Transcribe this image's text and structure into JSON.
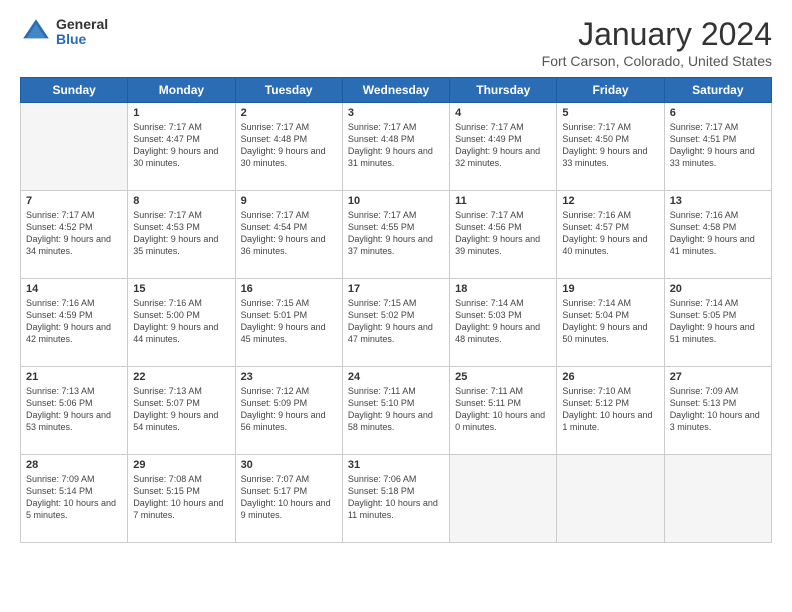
{
  "header": {
    "logo_general": "General",
    "logo_blue": "Blue",
    "title": "January 2024",
    "location": "Fort Carson, Colorado, United States"
  },
  "days_of_week": [
    "Sunday",
    "Monday",
    "Tuesday",
    "Wednesday",
    "Thursday",
    "Friday",
    "Saturday"
  ],
  "weeks": [
    [
      {
        "num": "",
        "sunrise": "",
        "sunset": "",
        "daylight": "",
        "gray": true
      },
      {
        "num": "1",
        "sunrise": "Sunrise: 7:17 AM",
        "sunset": "Sunset: 4:47 PM",
        "daylight": "Daylight: 9 hours and 30 minutes.",
        "gray": false
      },
      {
        "num": "2",
        "sunrise": "Sunrise: 7:17 AM",
        "sunset": "Sunset: 4:48 PM",
        "daylight": "Daylight: 9 hours and 30 minutes.",
        "gray": false
      },
      {
        "num": "3",
        "sunrise": "Sunrise: 7:17 AM",
        "sunset": "Sunset: 4:48 PM",
        "daylight": "Daylight: 9 hours and 31 minutes.",
        "gray": false
      },
      {
        "num": "4",
        "sunrise": "Sunrise: 7:17 AM",
        "sunset": "Sunset: 4:49 PM",
        "daylight": "Daylight: 9 hours and 32 minutes.",
        "gray": false
      },
      {
        "num": "5",
        "sunrise": "Sunrise: 7:17 AM",
        "sunset": "Sunset: 4:50 PM",
        "daylight": "Daylight: 9 hours and 33 minutes.",
        "gray": false
      },
      {
        "num": "6",
        "sunrise": "Sunrise: 7:17 AM",
        "sunset": "Sunset: 4:51 PM",
        "daylight": "Daylight: 9 hours and 33 minutes.",
        "gray": false
      }
    ],
    [
      {
        "num": "7",
        "sunrise": "Sunrise: 7:17 AM",
        "sunset": "Sunset: 4:52 PM",
        "daylight": "Daylight: 9 hours and 34 minutes.",
        "gray": false
      },
      {
        "num": "8",
        "sunrise": "Sunrise: 7:17 AM",
        "sunset": "Sunset: 4:53 PM",
        "daylight": "Daylight: 9 hours and 35 minutes.",
        "gray": false
      },
      {
        "num": "9",
        "sunrise": "Sunrise: 7:17 AM",
        "sunset": "Sunset: 4:54 PM",
        "daylight": "Daylight: 9 hours and 36 minutes.",
        "gray": false
      },
      {
        "num": "10",
        "sunrise": "Sunrise: 7:17 AM",
        "sunset": "Sunset: 4:55 PM",
        "daylight": "Daylight: 9 hours and 37 minutes.",
        "gray": false
      },
      {
        "num": "11",
        "sunrise": "Sunrise: 7:17 AM",
        "sunset": "Sunset: 4:56 PM",
        "daylight": "Daylight: 9 hours and 39 minutes.",
        "gray": false
      },
      {
        "num": "12",
        "sunrise": "Sunrise: 7:16 AM",
        "sunset": "Sunset: 4:57 PM",
        "daylight": "Daylight: 9 hours and 40 minutes.",
        "gray": false
      },
      {
        "num": "13",
        "sunrise": "Sunrise: 7:16 AM",
        "sunset": "Sunset: 4:58 PM",
        "daylight": "Daylight: 9 hours and 41 minutes.",
        "gray": false
      }
    ],
    [
      {
        "num": "14",
        "sunrise": "Sunrise: 7:16 AM",
        "sunset": "Sunset: 4:59 PM",
        "daylight": "Daylight: 9 hours and 42 minutes.",
        "gray": false
      },
      {
        "num": "15",
        "sunrise": "Sunrise: 7:16 AM",
        "sunset": "Sunset: 5:00 PM",
        "daylight": "Daylight: 9 hours and 44 minutes.",
        "gray": false
      },
      {
        "num": "16",
        "sunrise": "Sunrise: 7:15 AM",
        "sunset": "Sunset: 5:01 PM",
        "daylight": "Daylight: 9 hours and 45 minutes.",
        "gray": false
      },
      {
        "num": "17",
        "sunrise": "Sunrise: 7:15 AM",
        "sunset": "Sunset: 5:02 PM",
        "daylight": "Daylight: 9 hours and 47 minutes.",
        "gray": false
      },
      {
        "num": "18",
        "sunrise": "Sunrise: 7:14 AM",
        "sunset": "Sunset: 5:03 PM",
        "daylight": "Daylight: 9 hours and 48 minutes.",
        "gray": false
      },
      {
        "num": "19",
        "sunrise": "Sunrise: 7:14 AM",
        "sunset": "Sunset: 5:04 PM",
        "daylight": "Daylight: 9 hours and 50 minutes.",
        "gray": false
      },
      {
        "num": "20",
        "sunrise": "Sunrise: 7:14 AM",
        "sunset": "Sunset: 5:05 PM",
        "daylight": "Daylight: 9 hours and 51 minutes.",
        "gray": false
      }
    ],
    [
      {
        "num": "21",
        "sunrise": "Sunrise: 7:13 AM",
        "sunset": "Sunset: 5:06 PM",
        "daylight": "Daylight: 9 hours and 53 minutes.",
        "gray": false
      },
      {
        "num": "22",
        "sunrise": "Sunrise: 7:13 AM",
        "sunset": "Sunset: 5:07 PM",
        "daylight": "Daylight: 9 hours and 54 minutes.",
        "gray": false
      },
      {
        "num": "23",
        "sunrise": "Sunrise: 7:12 AM",
        "sunset": "Sunset: 5:09 PM",
        "daylight": "Daylight: 9 hours and 56 minutes.",
        "gray": false
      },
      {
        "num": "24",
        "sunrise": "Sunrise: 7:11 AM",
        "sunset": "Sunset: 5:10 PM",
        "daylight": "Daylight: 9 hours and 58 minutes.",
        "gray": false
      },
      {
        "num": "25",
        "sunrise": "Sunrise: 7:11 AM",
        "sunset": "Sunset: 5:11 PM",
        "daylight": "Daylight: 10 hours and 0 minutes.",
        "gray": false
      },
      {
        "num": "26",
        "sunrise": "Sunrise: 7:10 AM",
        "sunset": "Sunset: 5:12 PM",
        "daylight": "Daylight: 10 hours and 1 minute.",
        "gray": false
      },
      {
        "num": "27",
        "sunrise": "Sunrise: 7:09 AM",
        "sunset": "Sunset: 5:13 PM",
        "daylight": "Daylight: 10 hours and 3 minutes.",
        "gray": false
      }
    ],
    [
      {
        "num": "28",
        "sunrise": "Sunrise: 7:09 AM",
        "sunset": "Sunset: 5:14 PM",
        "daylight": "Daylight: 10 hours and 5 minutes.",
        "gray": false
      },
      {
        "num": "29",
        "sunrise": "Sunrise: 7:08 AM",
        "sunset": "Sunset: 5:15 PM",
        "daylight": "Daylight: 10 hours and 7 minutes.",
        "gray": false
      },
      {
        "num": "30",
        "sunrise": "Sunrise: 7:07 AM",
        "sunset": "Sunset: 5:17 PM",
        "daylight": "Daylight: 10 hours and 9 minutes.",
        "gray": false
      },
      {
        "num": "31",
        "sunrise": "Sunrise: 7:06 AM",
        "sunset": "Sunset: 5:18 PM",
        "daylight": "Daylight: 10 hours and 11 minutes.",
        "gray": false
      },
      {
        "num": "",
        "sunrise": "",
        "sunset": "",
        "daylight": "",
        "gray": true
      },
      {
        "num": "",
        "sunrise": "",
        "sunset": "",
        "daylight": "",
        "gray": true
      },
      {
        "num": "",
        "sunrise": "",
        "sunset": "",
        "daylight": "",
        "gray": true
      }
    ]
  ]
}
